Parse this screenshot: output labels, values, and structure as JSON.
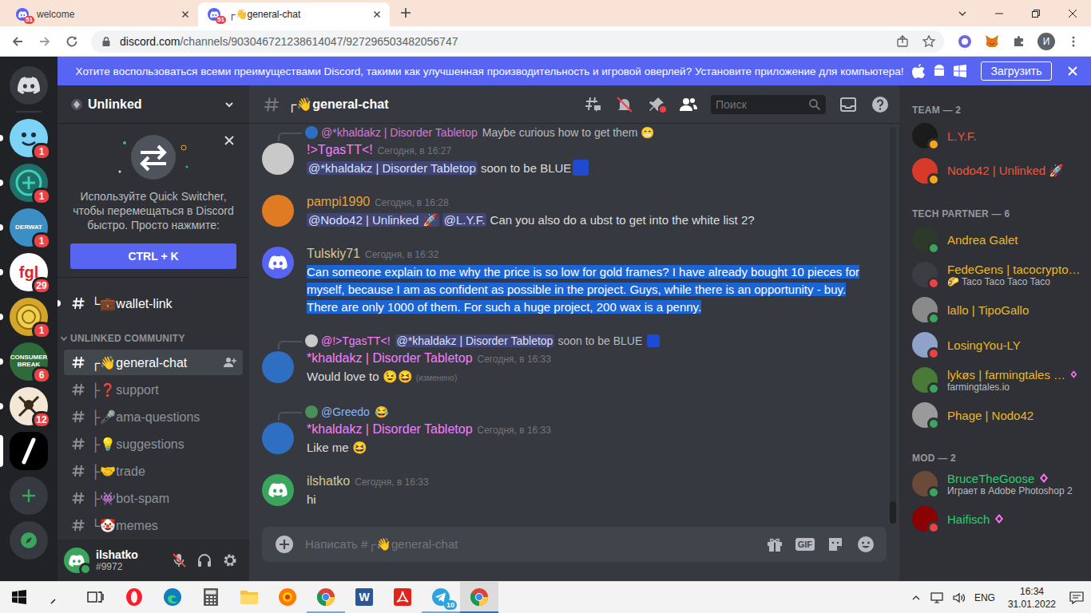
{
  "browser": {
    "tabs": [
      {
        "label": "welcome",
        "badge": "51",
        "selected": false
      },
      {
        "label": "┌👋general-chat",
        "badge": "51",
        "selected": true
      }
    ],
    "url_host": "discord.com",
    "url_path": "/channels/903046721238614047/927296503482056747",
    "profile": "И"
  },
  "banner": {
    "text": "Хотите воспользоваться всеми преимуществами Discord, такими как улучшенная производительность и игровой оверлей? Установите приложение для компьютера!",
    "button": "Загрузить"
  },
  "guilds": [
    {
      "kind": "home",
      "badge": "",
      "color": "#36393f",
      "unread": false,
      "selected": false
    },
    {
      "kind": "face",
      "badge": "1",
      "color": "#7dd3f5",
      "unread": true,
      "selected": false
    },
    {
      "kind": "plus",
      "badge": "1",
      "color": "#1f6f6a",
      "unread": true,
      "selected": false
    },
    {
      "kind": "text",
      "label": "DERWAT",
      "badge": "1",
      "color": "#3b8fc4",
      "unread": true,
      "selected": false
    },
    {
      "kind": "logo",
      "label": "fgl",
      "badge": "29",
      "color": "#ffffff",
      "unread": true,
      "selected": false
    },
    {
      "kind": "coin",
      "badge": "1",
      "color": "#d4a52a",
      "unread": true,
      "selected": false
    },
    {
      "kind": "text",
      "label": "CONSUMER BREAK",
      "badge": "6",
      "color": "#2f6b3a",
      "unread": true,
      "selected": false
    },
    {
      "kind": "swords",
      "badge": "12",
      "color": "#f2e8d5",
      "unread": true,
      "selected": false
    },
    {
      "kind": "slash",
      "badge": "",
      "color": "#000000",
      "unread": false,
      "selected": true
    },
    {
      "kind": "add",
      "badge": "",
      "color": "#36393f",
      "unread": false,
      "selected": false
    },
    {
      "kind": "explore",
      "badge": "",
      "color": "#36393f",
      "unread": false,
      "selected": false
    }
  ],
  "server": {
    "name": "Unlinked"
  },
  "switcher": {
    "text": "Используйте Quick Switcher, чтобы перемещаться в Discord быстро. Просто нажмите:",
    "button": "CTRL + K"
  },
  "channels": [
    {
      "kind": "channel",
      "name": "└💼wallet-link",
      "selected": false,
      "unread": true
    },
    {
      "kind": "category",
      "name": "UNLINKED COMMUNITY",
      "expanded": true
    },
    {
      "kind": "channel",
      "name": "┌👋general-chat",
      "selected": true,
      "unread": false
    },
    {
      "kind": "channel",
      "name": "├❓support",
      "selected": false,
      "unread": false
    },
    {
      "kind": "channel",
      "name": "├🎤ama-questions",
      "selected": false,
      "unread": false
    },
    {
      "kind": "channel",
      "name": "├💡suggestions",
      "selected": false,
      "unread": false
    },
    {
      "kind": "channel",
      "name": "├🤝trade",
      "selected": false,
      "unread": false
    },
    {
      "kind": "channel",
      "name": "├👾bot-spam",
      "selected": false,
      "unread": false
    },
    {
      "kind": "channel",
      "name": "└🤡memes",
      "selected": false,
      "unread": false
    }
  ],
  "user": {
    "name": "ilshatko",
    "tag": "#9972",
    "mic_muted": true,
    "status_color": "#3ba55d",
    "avatar_color": "#3ba55d"
  },
  "chat": {
    "channel": "┌👋general-chat",
    "search_placeholder": "Поиск",
    "input_placeholder": "Написать #┌👋general-chat",
    "gif": "GIF"
  },
  "messages": [
    {
      "author": "!>TgasTT<!",
      "author_color": "#f47fff",
      "time": "Сегодня, в 16:27",
      "avatar": {
        "kind": "plain",
        "color": "#c9c9c9"
      },
      "selected": false,
      "edited": "",
      "reply": {
        "avatar": "#2f6fc1",
        "parts": [
          {
            "kind": "author",
            "text": "@*khaldakz | Disorder Tabletop",
            "color": "#d17ad1"
          },
          {
            "kind": "text",
            "text": "Maybe curious how to get them 😁"
          }
        ]
      },
      "parts": [
        {
          "kind": "mention",
          "text": "@*khaldakz | Disorder Tabletop"
        },
        {
          "kind": "text",
          "text": " soon to be BLUE"
        },
        {
          "kind": "emoji",
          "color": "#1f4bd1"
        }
      ]
    },
    {
      "author": "pampi1990",
      "author_color": "#e8a33a",
      "time": "Сегодня, в 16:28",
      "avatar": {
        "kind": "plain",
        "color": "#e07b24"
      },
      "selected": false,
      "edited": "",
      "reply": null,
      "parts": [
        {
          "kind": "mention",
          "text": "@Nodo42 | Unlinked 🚀"
        },
        {
          "kind": "text",
          "text": " "
        },
        {
          "kind": "mention",
          "text": "@L.Y.F."
        },
        {
          "kind": "text",
          "text": " Can you also do a ubst to get into the white list 2?"
        }
      ]
    },
    {
      "author": "Tulskiy71",
      "author_color": "#d8c98f",
      "time": "Сегодня, в 16:32",
      "avatar": {
        "kind": "default",
        "color": "#5865f2"
      },
      "selected": true,
      "edited": "",
      "reply": null,
      "parts": [
        {
          "kind": "text",
          "text": "Can someone explain to me why the price is so low for gold frames? I have already bought 10 pieces for myself, because I am as confident as possible in the project. Guys, while there is an opportunity - buy. There are only 1000 of them. For such a huge project, 200 wax is a penny."
        }
      ]
    },
    {
      "author": "*khaldakz | Disorder Tabletop",
      "author_color": "#f47fff",
      "time": "Сегодня, в 16:33",
      "avatar": {
        "kind": "plain",
        "color": "#2f6fc1"
      },
      "selected": false,
      "edited": "(изменено)",
      "reply": {
        "avatar": "#c9c9c9",
        "parts": [
          {
            "kind": "author",
            "text": "@!>TgasTT<!",
            "color": "#f47fff"
          },
          {
            "kind": "mention",
            "text": "@*khaldakz | Disorder Tabletop"
          },
          {
            "kind": "text",
            "text": " soon to be BLUE"
          },
          {
            "kind": "emoji",
            "color": "#1f4bd1"
          }
        ]
      },
      "parts": [
        {
          "kind": "text",
          "text": "Would love to 😉😆"
        }
      ]
    },
    {
      "author": "*khaldakz | Disorder Tabletop",
      "author_color": "#f47fff",
      "time": "Сегодня, в 16:33",
      "avatar": {
        "kind": "plain",
        "color": "#2f6fc1"
      },
      "selected": false,
      "edited": "",
      "reply": {
        "avatar": "#4a8f5a",
        "parts": [
          {
            "kind": "author",
            "text": "@Greedo",
            "color": "#8ab4f8"
          },
          {
            "kind": "text",
            "text": "😂"
          }
        ]
      },
      "parts": [
        {
          "kind": "text",
          "text": "Like me 😆"
        }
      ]
    },
    {
      "author": "ilshatko",
      "author_color": "#d8c98f",
      "time": "Сегодня, в 16:33",
      "avatar": {
        "kind": "default",
        "color": "#3ba55d"
      },
      "selected": false,
      "edited": "",
      "reply": null,
      "parts": [
        {
          "kind": "text",
          "text": "hi"
        }
      ]
    }
  ],
  "members": [
    {
      "title": "TEAM — 2",
      "members": [
        {
          "name": "L.Y.F.",
          "color": "#e9573f",
          "status": "#faa61a",
          "activity": "",
          "boost": false,
          "avatar": "#1b1b1b"
        },
        {
          "name": "Nodo42 | Unlinked 🚀",
          "color": "#e9573f",
          "status": "#faa61a",
          "activity": "",
          "boost": false,
          "avatar": "#d83a2a"
        }
      ]
    },
    {
      "title": "TECH PARTNER — 6",
      "members": [
        {
          "name": "Andrea Galet",
          "color": "#e9b824",
          "status": "#3ba55d",
          "activity": "",
          "boost": false,
          "avatar": "#2d3a2a"
        },
        {
          "name": "FedeGens | tacocrypto…",
          "color": "#e9b824",
          "status": "#ed4245",
          "activity": "🌮 Taco Taco Taco Taco",
          "boost": false,
          "avatar": "#3a3d42"
        },
        {
          "name": "lallo | TipoGallo",
          "color": "#e9b824",
          "status": "#3ba55d",
          "activity": "",
          "boost": false,
          "avatar": "#8a8a8a"
        },
        {
          "name": "LosingYou-LY",
          "color": "#e9b824",
          "status": "#ed4245",
          "activity": "",
          "boost": false,
          "avatar": "#8fa3c8"
        },
        {
          "name": "lykøs | farmingtales …",
          "color": "#e9b824",
          "status": "#3ba55d",
          "activity": "farmingtales.io",
          "boost": true,
          "avatar": "#4a7a3a"
        },
        {
          "name": "Phage | Nodo42",
          "color": "#e9b824",
          "status": "#3ba55d",
          "activity": "",
          "boost": false,
          "avatar": "#9a9a9a"
        }
      ]
    },
    {
      "title": "MOD — 2",
      "members": [
        {
          "name": "BruceTheGoose",
          "color": "#2ecc71",
          "status": "#3ba55d",
          "activity": "Играет в Adobe Photoshop 2",
          "boost": true,
          "avatar": "#6b4a3a"
        },
        {
          "name": "Haifisch",
          "color": "#2ecc71",
          "status": "#ed4245",
          "activity": "",
          "boost": true,
          "avatar": "#8b0000"
        }
      ]
    }
  ],
  "taskbar": {
    "apps": [
      {
        "kind": "start",
        "color": "#111111",
        "open": false,
        "selected": false
      },
      {
        "kind": "search",
        "color": "#111111",
        "open": false,
        "selected": false
      },
      {
        "kind": "taskview",
        "color": "#111111",
        "open": false,
        "selected": false
      },
      {
        "kind": "opera",
        "color": "#ff1b2d",
        "open": false,
        "selected": false
      },
      {
        "kind": "edge",
        "color": "#0f7dc2",
        "open": false,
        "selected": false
      },
      {
        "kind": "calc",
        "color": "#5a5a5a",
        "open": false,
        "selected": false
      },
      {
        "kind": "folder",
        "color": "#f6c343",
        "open": false,
        "selected": false
      },
      {
        "kind": "yandex",
        "color": "#ff7a00",
        "open": false,
        "selected": false
      },
      {
        "kind": "chrome",
        "color": "#4285f4",
        "open": true,
        "selected": false
      },
      {
        "kind": "word",
        "label": "W",
        "color": "#2b579a",
        "open": false,
        "selected": false
      },
      {
        "kind": "acrobat",
        "color": "#e2231a",
        "open": false,
        "selected": false
      },
      {
        "kind": "telegram",
        "badge": "10",
        "color": "#2aa3df",
        "open": true,
        "selected": false
      },
      {
        "kind": "chrome",
        "color": "#4285f4",
        "open": true,
        "selected": true
      }
    ],
    "lang": "ENG",
    "time": "16:34",
    "date": "31.01.2022"
  }
}
